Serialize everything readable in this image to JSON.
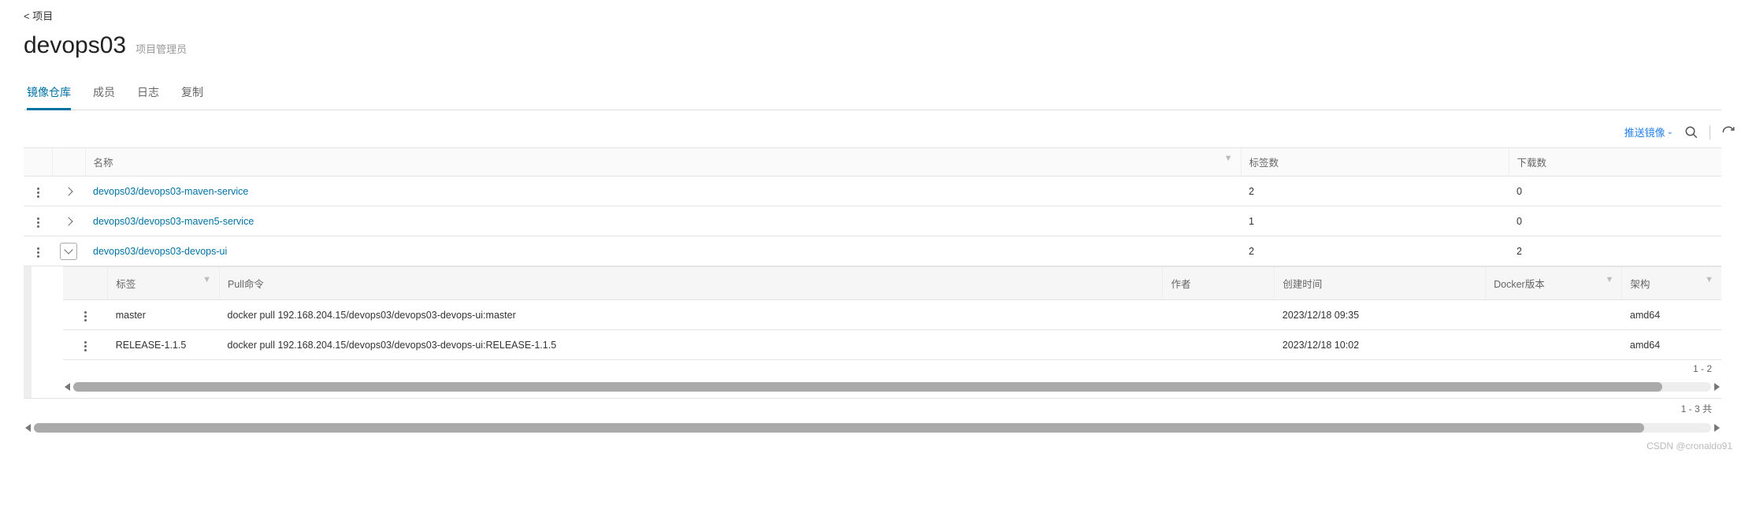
{
  "breadcrumb": "< 项目",
  "title": "devops03",
  "role": "项目管理员",
  "tabs": [
    "镜像仓库",
    "成员",
    "日志",
    "复制"
  ],
  "active_tab": 0,
  "toolbar": {
    "push_label": "推送镜像"
  },
  "columns": {
    "name": "名称",
    "tags": "标签数",
    "downloads": "下载数"
  },
  "repos": [
    {
      "name": "devops03/devops03-maven-service",
      "tags": "2",
      "downloads": "0",
      "expanded": false
    },
    {
      "name": "devops03/devops03-maven5-service",
      "tags": "1",
      "downloads": "0",
      "expanded": false
    },
    {
      "name": "devops03/devops03-devops-ui",
      "tags": "2",
      "downloads": "2",
      "expanded": true
    }
  ],
  "inner_columns": {
    "tag": "标签",
    "pull": "Pull命令",
    "author": "作者",
    "created": "创建时间",
    "docker_ver": "Docker版本",
    "arch": "架构"
  },
  "inner_rows": [
    {
      "tag": "master",
      "pull": "docker pull 192.168.204.15/devops03/devops03-devops-ui:master",
      "author": "",
      "created": "2023/12/18 09:35",
      "docker_ver": "",
      "arch": "amd64"
    },
    {
      "tag": "RELEASE-1.1.5",
      "pull": "docker pull 192.168.204.15/devops03/devops03-devops-ui:RELEASE-1.1.5",
      "author": "",
      "created": "2023/12/18 10:02",
      "docker_ver": "",
      "arch": "amd64"
    }
  ],
  "inner_pagination": "1 - 2",
  "outer_pagination": "1 - 3 共",
  "watermark": "CSDN @cronaldo91"
}
